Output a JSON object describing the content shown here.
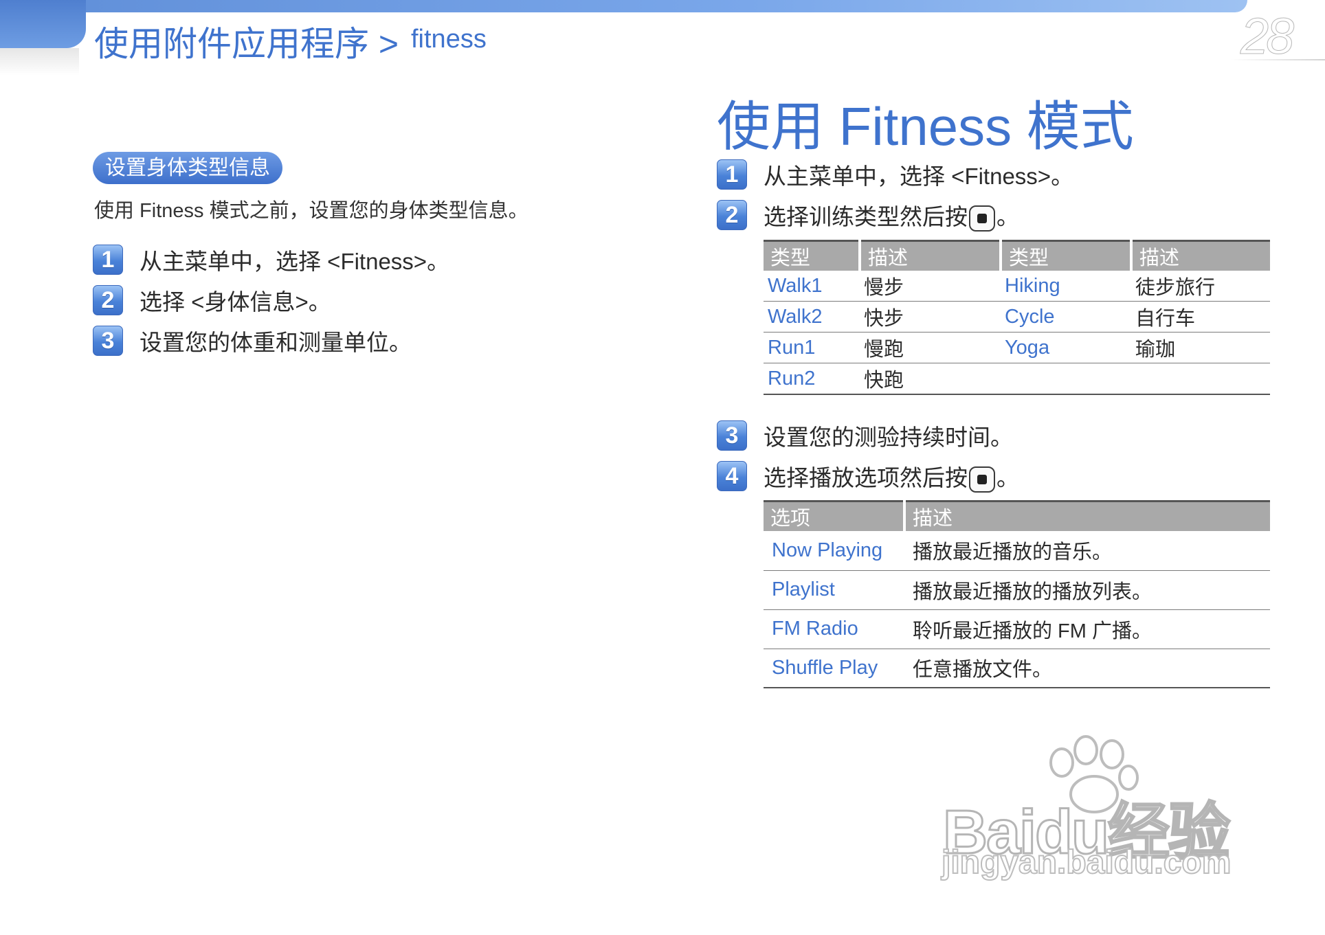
{
  "header": {
    "breadcrumb": "使用附件应用程序 >",
    "breadcrumb_sub": "fitness",
    "page_number": "28"
  },
  "left": {
    "section_pill": "设置身体类型信息",
    "intro": "使用 Fitness 模式之前，设置您的身体类型信息。",
    "steps": [
      {
        "num": "1",
        "text": "从主菜单中，选择 <Fitness>。"
      },
      {
        "num": "2",
        "text": "选择 <身体信息>。"
      },
      {
        "num": "3",
        "text": "设置您的体重和测量单位。"
      }
    ]
  },
  "right": {
    "title": "使用 Fitness 模式",
    "steps": [
      {
        "num": "1",
        "text": "从主菜单中，选择 <Fitness>。"
      },
      {
        "num": "2",
        "text": "选择训练类型然后按",
        "suffix": "。"
      },
      {
        "num": "3",
        "text": "设置您的测验持续时间。"
      },
      {
        "num": "4",
        "text": "选择播放选项然后按",
        "suffix": "。"
      }
    ],
    "workout_table": {
      "headers": [
        "类型",
        "描述",
        "类型",
        "描述"
      ],
      "rows": [
        [
          "Walk1",
          "慢步",
          "Hiking",
          "徒步旅行"
        ],
        [
          "Walk2",
          "快步",
          "Cycle",
          "自行车"
        ],
        [
          "Run1",
          "慢跑",
          "Yoga",
          "瑜珈"
        ],
        [
          "Run2",
          "快跑",
          "",
          ""
        ]
      ]
    },
    "play_table": {
      "headers": [
        "选项",
        "描述"
      ],
      "rows": [
        [
          "Now Playing",
          "播放最近播放的音乐。"
        ],
        [
          "Playlist",
          "播放最近播放的播放列表。"
        ],
        [
          "FM Radio",
          "聆听最近播放的 FM 广播。"
        ],
        [
          "Shuffle Play",
          "任意播放文件。"
        ]
      ]
    }
  },
  "watermark": {
    "main": "Baidu经验",
    "sub": "jingyan.baidu.com"
  },
  "colors": {
    "accent_blue": "#3f73cd",
    "header_gray": "#a9a9a9"
  },
  "icons": {
    "control_button": "center-button-icon",
    "watermark": "paw-print-icon"
  }
}
